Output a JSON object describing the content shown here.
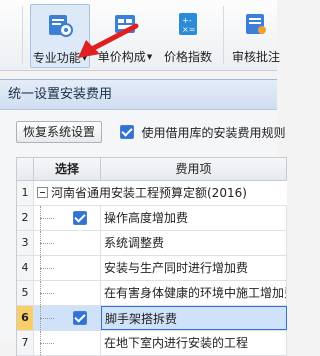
{
  "ribbon": {
    "buttons": [
      {
        "label": "专业功能",
        "has_dropdown": true,
        "icon": "gear-document-icon"
      },
      {
        "label": "单价构成",
        "has_dropdown": true,
        "icon": "price-composition-icon"
      },
      {
        "label": "价格指数",
        "has_dropdown": false,
        "icon": "calculator-icon"
      },
      {
        "label": "审核批注",
        "has_dropdown": false,
        "icon": "review-icon"
      }
    ]
  },
  "dialog": {
    "title": "统一设置安装费用",
    "reset_button": "恢复系统设置",
    "checkbox_label": "使用借用库的安装费用规则",
    "checkbox_checked": true,
    "table": {
      "headers": {
        "select": "选择",
        "item": "费用项"
      },
      "rows": [
        {
          "num": "1",
          "text": "河南省通用安装工程预算定额(2016)",
          "checked": null,
          "parent": true,
          "selected": false
        },
        {
          "num": "2",
          "text": "操作高度增加费",
          "checked": true,
          "parent": false,
          "selected": false
        },
        {
          "num": "3",
          "text": "系统调整费",
          "checked": false,
          "parent": false,
          "selected": false
        },
        {
          "num": "4",
          "text": "安装与生产同时进行增加费",
          "checked": false,
          "parent": false,
          "selected": false
        },
        {
          "num": "5",
          "text": "在有害身体健康的环境中施工增加费",
          "checked": false,
          "parent": false,
          "selected": false
        },
        {
          "num": "6",
          "text": "脚手架搭拆费",
          "checked": true,
          "parent": false,
          "selected": true
        },
        {
          "num": "7",
          "text": "在地下室内进行安装的工程",
          "checked": false,
          "parent": false,
          "selected": false
        }
      ]
    }
  },
  "colors": {
    "accent": "#2f73d8",
    "selected_row": "#cfe2f9",
    "arrow": "#e02020"
  }
}
